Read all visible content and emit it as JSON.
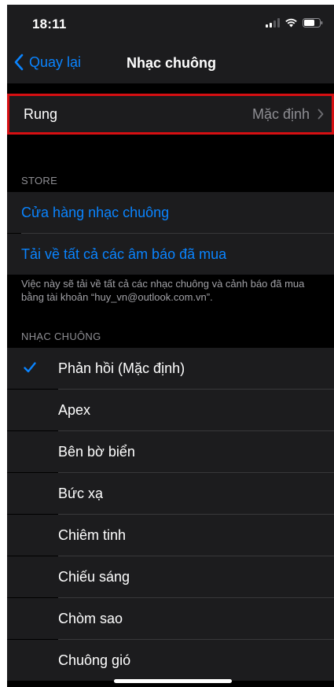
{
  "status_bar": {
    "time": "18:11",
    "icons": [
      "signal-icon",
      "wifi-icon",
      "battery-icon"
    ]
  },
  "nav": {
    "back_label": "Quay lại",
    "title": "Nhạc chuông"
  },
  "vibration": {
    "label": "Rung",
    "value": "Mặc định"
  },
  "store_section": {
    "header": "STORE",
    "items": [
      {
        "label": "Cửa hàng nhạc chuông"
      },
      {
        "label": "Tải về tất cả các âm báo đã mua"
      }
    ],
    "footer": "Việc này sẽ tải về tất cả các nhạc chuông và cảnh báo đã mua bằng tài khoản “huy_vn@outlook.com.vn”."
  },
  "ringtones_section": {
    "header": "NHẠC CHUÔNG",
    "items": [
      {
        "label": "Phản hồi (Mặc định)",
        "selected": true
      },
      {
        "label": "Apex",
        "selected": false
      },
      {
        "label": "Bên bờ biển",
        "selected": false
      },
      {
        "label": "Bức xạ",
        "selected": false
      },
      {
        "label": "Chiêm tinh",
        "selected": false
      },
      {
        "label": "Chiếu sáng",
        "selected": false
      },
      {
        "label": "Chòm sao",
        "selected": false
      },
      {
        "label": "Chuông gió",
        "selected": false
      }
    ]
  },
  "colors": {
    "accent": "#0a84ff",
    "highlight_border": "#d60f12",
    "background": "#000000",
    "cell": "#1c1c1e"
  }
}
